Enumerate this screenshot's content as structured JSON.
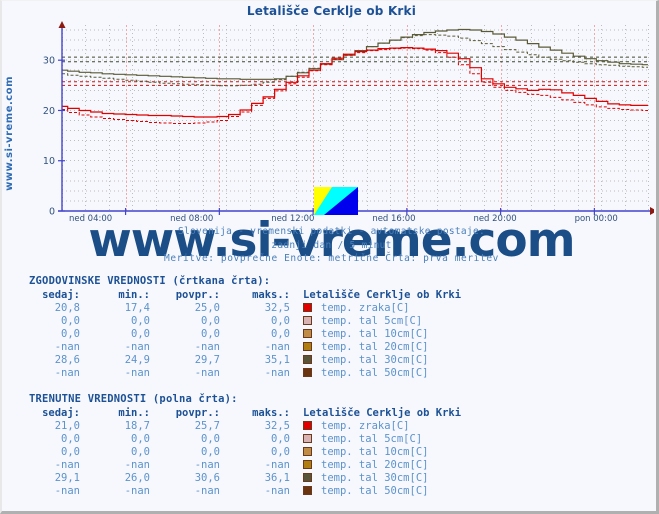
{
  "page": {
    "title": "Letališče Cerklje ob Krki",
    "side_label": "www.si-vreme.com",
    "watermark": "www.si-vreme.com"
  },
  "subtitle": {
    "line1": "Slovenija - vremenski podatki - avtomatske postaje:",
    "line2": "zadnji dan / 5 minut",
    "line3": "Meritve: povprečne  Enote: metrične  Črta: prva meritev"
  },
  "logo": {
    "name": "si-vreme-logo",
    "color_yellow": "#ffff00",
    "color_cyan": "#00ffff",
    "color_blue": "#0000ee"
  },
  "axes": {
    "y_ticks": [
      "0",
      "10",
      "20",
      "30"
    ],
    "y_values": [
      0,
      10,
      20,
      30
    ],
    "ymin": 0,
    "ymax": 37,
    "x_ticks": [
      {
        "label": "ned 04:00",
        "pos": 0.1085
      },
      {
        "label": "ned 08:00",
        "pos": 0.2685
      },
      {
        "label": "ned 12:00",
        "pos": 0.4285
      },
      {
        "label": "ned 16:00",
        "pos": 0.5885
      },
      {
        "label": "ned 20:00",
        "pos": 0.7485
      },
      {
        "label": "pon 00:00",
        "pos": 0.9085
      }
    ],
    "axis_color": "#4444cc",
    "arrow_color": "#8b1a12",
    "grid_minor_color": "#bdbdbd",
    "grid_major_color": "#f0a8a8"
  },
  "chart_data": {
    "type": "line",
    "title": "Letališče Cerklje ob Krki",
    "xlabel": "",
    "ylabel": "",
    "ylim": [
      0,
      37
    ],
    "grid": true,
    "legend": "right",
    "x_tick_labels": [
      "ned 04:00",
      "ned 08:00",
      "ned 12:00",
      "ned 16:00",
      "ned 20:00",
      "pon 00:00"
    ],
    "y_tick_labels": [
      "0",
      "10",
      "20",
      "30"
    ],
    "series": [
      {
        "name": "temp. zraka[C] (trenutne)",
        "color": "#e00000",
        "style": "solid",
        "values": [
          20.8,
          20.4,
          20.0,
          19.7,
          19.4,
          19.3,
          19.2,
          19.1,
          19.0,
          19.0,
          18.9,
          18.8,
          18.7,
          18.7,
          18.8,
          19.2,
          20.1,
          21.4,
          22.7,
          24.2,
          25.6,
          26.9,
          28.0,
          29.3,
          30.4,
          31.2,
          31.7,
          32.0,
          32.3,
          32.4,
          32.5,
          32.4,
          32.2,
          31.9,
          31.4,
          30.3,
          28.5,
          26.3,
          25.3,
          24.6,
          24.3,
          24.0,
          24.2,
          24.1,
          23.5,
          23.0,
          22.4,
          21.8,
          21.3,
          21.1,
          21.0,
          21.0
        ]
      },
      {
        "name": "temp. zraka[C] (zgodovinske)",
        "color": "#e00000",
        "style": "dashed",
        "values": [
          20.2,
          19.6,
          19.1,
          18.7,
          18.4,
          18.2,
          18.0,
          17.8,
          17.6,
          17.5,
          17.4,
          17.4,
          17.5,
          17.7,
          18.0,
          18.8,
          19.7,
          21.0,
          22.4,
          23.9,
          25.3,
          26.6,
          27.9,
          29.1,
          30.2,
          31.0,
          31.5,
          31.9,
          32.1,
          32.3,
          32.4,
          32.3,
          32.0,
          31.5,
          30.6,
          29.1,
          27.3,
          25.6,
          24.6,
          24.0,
          23.6,
          23.2,
          23.0,
          22.6,
          22.1,
          21.6,
          21.1,
          20.7,
          20.4,
          20.2,
          20.1,
          20.0
        ]
      },
      {
        "name": "temp. tal 30cm[C] (trenutne)",
        "color": "#5a5a36",
        "style": "solid",
        "values": [
          28.0,
          27.8,
          27.6,
          27.5,
          27.3,
          27.2,
          27.1,
          27.0,
          26.9,
          26.8,
          26.7,
          26.6,
          26.5,
          26.4,
          26.3,
          26.3,
          26.2,
          26.2,
          26.2,
          26.3,
          26.8,
          27.5,
          28.3,
          29.2,
          30.1,
          31.0,
          31.9,
          32.7,
          33.4,
          34.0,
          34.6,
          35.1,
          35.5,
          35.8,
          36.0,
          36.1,
          36.0,
          35.7,
          35.2,
          34.6,
          34.0,
          33.3,
          32.6,
          32.0,
          31.4,
          30.8,
          30.3,
          29.9,
          29.6,
          29.3,
          29.2,
          29.1
        ]
      },
      {
        "name": "temp. tal 30cm[C] (zgodovinske)",
        "color": "#5a5a36",
        "style": "dashed",
        "values": [
          27.3,
          27.0,
          26.8,
          26.6,
          26.4,
          26.2,
          26.0,
          25.8,
          25.6,
          25.4,
          25.3,
          25.2,
          25.1,
          25.0,
          24.9,
          24.9,
          25.0,
          25.2,
          25.6,
          26.1,
          26.8,
          27.6,
          28.4,
          29.3,
          30.2,
          31.1,
          31.9,
          32.7,
          33.4,
          34.0,
          34.5,
          34.9,
          35.1,
          35.0,
          34.8,
          34.4,
          33.9,
          33.3,
          32.7,
          32.1,
          31.6,
          31.1,
          30.6,
          30.2,
          29.9,
          29.6,
          29.3,
          29.1,
          29.0,
          28.8,
          28.7,
          28.6
        ]
      }
    ],
    "reference_lines": [
      {
        "name": "temp. zraka trenutne povpr.",
        "value": 25.7,
        "color": "#d01010",
        "style": "dashed"
      },
      {
        "name": "temp. zraka zgodovinske povpr.",
        "value": 25.0,
        "color": "#d01010",
        "style": "dashed"
      },
      {
        "name": "temp. tal 30cm trenutne povpr.",
        "value": 30.6,
        "color": "#3f4a2c",
        "style": "dashed"
      },
      {
        "name": "temp. tal 30cm zgodovinske povpr.",
        "value": 29.7,
        "color": "#3f4a2c",
        "style": "dashed"
      }
    ]
  },
  "tables": {
    "historical": {
      "heading": "ZGODOVINSKE VREDNOSTI (črtkana črta):",
      "columns": [
        "sedaj:",
        "min.:",
        "povpr.:",
        "maks.:"
      ],
      "legend_title": "Letališče Cerklje ob Krki",
      "rows": [
        {
          "sedaj": "20,8",
          "min": "17,4",
          "povpr": "25,0",
          "maks": "32,5",
          "color": "#e00000",
          "label": "temp. zraka[C]"
        },
        {
          "sedaj": "0,0",
          "min": "0,0",
          "povpr": "0,0",
          "maks": "0,0",
          "color": "#d9b3b3",
          "label": "temp. tal  5cm[C]"
        },
        {
          "sedaj": "0,0",
          "min": "0,0",
          "povpr": "0,0",
          "maks": "0,0",
          "color": "#c08c46",
          "label": "temp. tal 10cm[C]"
        },
        {
          "sedaj": "-nan",
          "min": "-nan",
          "povpr": "-nan",
          "maks": "-nan",
          "color": "#b07d10",
          "label": "temp. tal 20cm[C]"
        },
        {
          "sedaj": "28,6",
          "min": "24,9",
          "povpr": "29,7",
          "maks": "35,1",
          "color": "#58543a",
          "label": "temp. tal 30cm[C]"
        },
        {
          "sedaj": "-nan",
          "min": "-nan",
          "povpr": "-nan",
          "maks": "-nan",
          "color": "#6b3410",
          "label": "temp. tal 50cm[C]"
        }
      ]
    },
    "current": {
      "heading": "TRENUTNE VREDNOSTI (polna črta):",
      "columns": [
        "sedaj:",
        "min.:",
        "povpr.:",
        "maks.:"
      ],
      "legend_title": "Letališče Cerklje ob Krki",
      "rows": [
        {
          "sedaj": "21,0",
          "min": "18,7",
          "povpr": "25,7",
          "maks": "32,5",
          "color": "#e00000",
          "label": "temp. zraka[C]"
        },
        {
          "sedaj": "0,0",
          "min": "0,0",
          "povpr": "0,0",
          "maks": "0,0",
          "color": "#d9b3b3",
          "label": "temp. tal  5cm[C]"
        },
        {
          "sedaj": "0,0",
          "min": "0,0",
          "povpr": "0,0",
          "maks": "0,0",
          "color": "#c08c46",
          "label": "temp. tal 10cm[C]"
        },
        {
          "sedaj": "-nan",
          "min": "-nan",
          "povpr": "-nan",
          "maks": "-nan",
          "color": "#b07d10",
          "label": "temp. tal 20cm[C]"
        },
        {
          "sedaj": "29,1",
          "min": "26,0",
          "povpr": "30,6",
          "maks": "36,1",
          "color": "#58543a",
          "label": "temp. tal 30cm[C]"
        },
        {
          "sedaj": "-nan",
          "min": "-nan",
          "povpr": "-nan",
          "maks": "-nan",
          "color": "#6b3410",
          "label": "temp. tal 50cm[C]"
        }
      ]
    }
  }
}
